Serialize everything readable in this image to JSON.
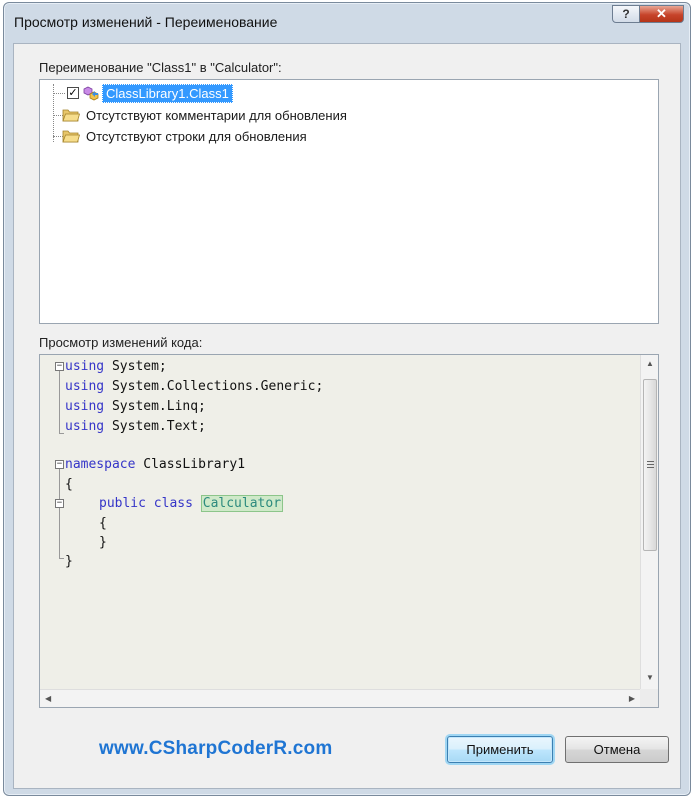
{
  "window": {
    "title": "Просмотр изменений - Переименование",
    "help_glyph": "?",
    "close_glyph": "✕"
  },
  "tree": {
    "label": "Переименование \"Class1\" в \"Calculator\":",
    "items": [
      {
        "text": "ClassLibrary1.Class1",
        "checked": true,
        "selected": true,
        "icon": "class-icon"
      },
      {
        "text": "Отсутствуют комментарии для обновления",
        "icon": "folder-icon"
      },
      {
        "text": "Отсутствуют строки для обновления",
        "icon": "folder-icon"
      }
    ],
    "check_glyph": "✓"
  },
  "code": {
    "label": "Просмотр изменений кода:",
    "lines": [
      {
        "kw": "using",
        "rest": " System;"
      },
      {
        "kw": "using",
        "rest": " System.Collections.Generic;"
      },
      {
        "kw": "using",
        "rest": " System.Linq;"
      },
      {
        "kw": "using",
        "rest": " System.Text;"
      },
      {
        "kw": "namespace",
        "rest": " ClassLibrary1"
      },
      {
        "text": "{"
      },
      {
        "kw": "public class",
        "highlight": "Calculator"
      },
      {
        "text": "{"
      },
      {
        "text": "}"
      },
      {
        "text": "}"
      }
    ],
    "fold_glyph": "−"
  },
  "footer": {
    "link": "www.CSharpCoderR.com",
    "apply_label": "Применить",
    "cancel_label": "Отмена"
  },
  "colors": {
    "keyword": "#3535c8",
    "highlight_bg": "#cfe9c9",
    "link": "#1f75d3",
    "selection": "#3399ff"
  }
}
